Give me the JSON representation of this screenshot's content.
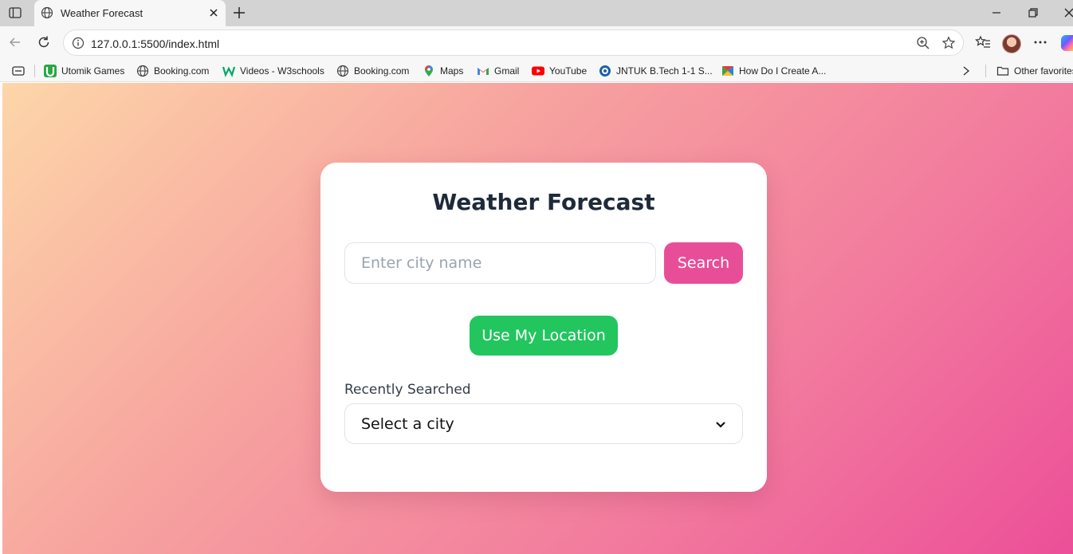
{
  "browser": {
    "tab": {
      "title": "Weather Forecast"
    },
    "address_bar": {
      "url": "127.0.0.1:5500/index.html"
    },
    "bookmarks": [
      {
        "label": "Utomik Games",
        "icon": "utomik-icon"
      },
      {
        "label": "Booking.com",
        "icon": "globe-icon"
      },
      {
        "label": "Videos - W3schools",
        "icon": "w3schools-icon"
      },
      {
        "label": "Booking.com",
        "icon": "globe-icon"
      },
      {
        "label": "Maps",
        "icon": "maps-pin-icon"
      },
      {
        "label": "Gmail",
        "icon": "gmail-icon"
      },
      {
        "label": "YouTube",
        "icon": "youtube-icon"
      },
      {
        "label": "JNTUK B.Tech 1-1 S...",
        "icon": "jntuk-icon"
      },
      {
        "label": "How Do I Create A...",
        "icon": "create-icon"
      }
    ],
    "other_favorites": "Other favorites"
  },
  "app": {
    "title": "Weather Forecast",
    "search": {
      "placeholder": "Enter city name",
      "value": "",
      "button_label": "Search"
    },
    "location_button_label": "Use My Location",
    "recent": {
      "label": "Recently Searched",
      "selected": "Select a city"
    }
  },
  "colors": {
    "accent_pink": "#e84e98",
    "location_green": "#22c55e",
    "title_text": "#1e2a3a"
  }
}
